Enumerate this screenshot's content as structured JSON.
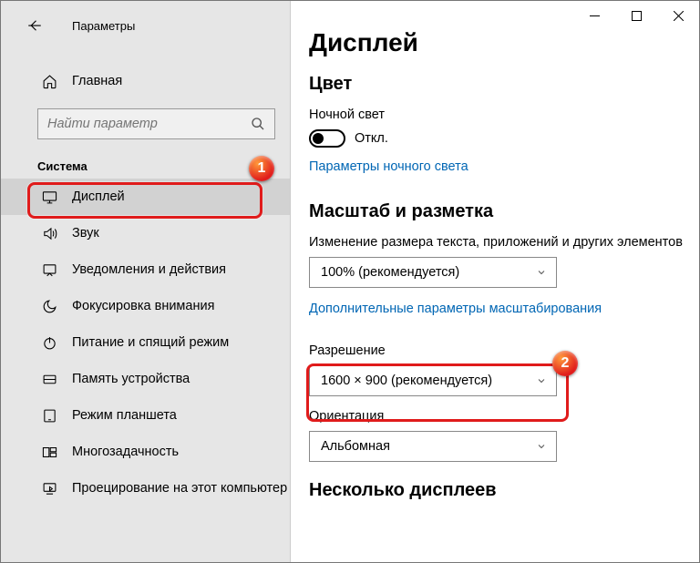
{
  "window": {
    "app_title": "Параметры"
  },
  "sidebar": {
    "home_label": "Главная",
    "search_placeholder": "Найти параметр",
    "section_title": "Система",
    "items": [
      {
        "label": "Дисплей"
      },
      {
        "label": "Звук"
      },
      {
        "label": "Уведомления и действия"
      },
      {
        "label": "Фокусировка внимания"
      },
      {
        "label": "Питание и спящий режим"
      },
      {
        "label": "Память устройства"
      },
      {
        "label": "Режим планшета"
      },
      {
        "label": "Многозадачность"
      },
      {
        "label": "Проецирование на этот компьютер"
      }
    ]
  },
  "content": {
    "page_title": "Дисплей",
    "section_color": "Цвет",
    "night_light_label": "Ночной свет",
    "night_light_state": "Откл.",
    "night_light_link": "Параметры ночного света",
    "section_scale": "Масштаб и разметка",
    "scale_caption": "Изменение размера текста, приложений и других элементов",
    "scale_value": "100% (рекомендуется)",
    "scale_link": "Дополнительные параметры масштабирования",
    "resolution_caption": "Разрешение",
    "resolution_value": "1600 × 900 (рекомендуется)",
    "orientation_caption": "Ориентация",
    "orientation_value": "Альбомная",
    "section_multi": "Несколько дисплеев"
  },
  "annotations": {
    "badge1": "1",
    "badge2": "2"
  }
}
